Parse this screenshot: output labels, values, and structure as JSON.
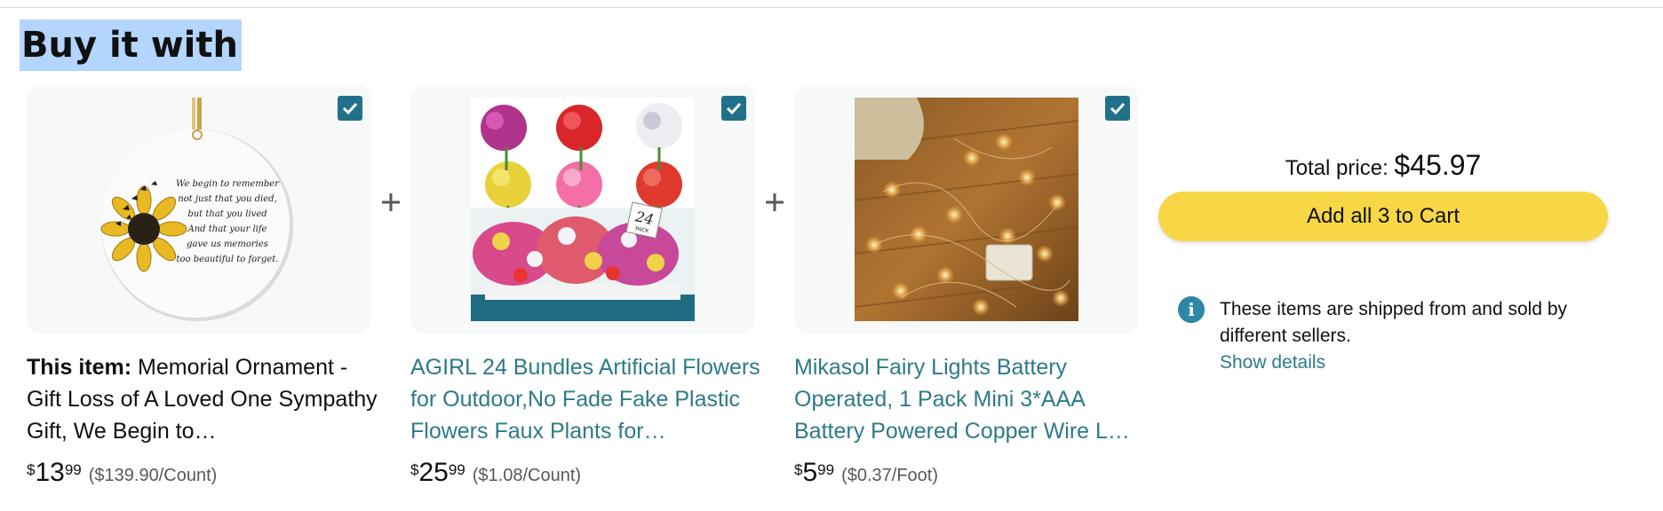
{
  "section": {
    "heading": "Buy it with"
  },
  "products": [
    {
      "label": "This item:",
      "title": "Memorial Ornament - Gift Loss of A Loved One Sympathy Gift, We Begin to…",
      "price_symbol": "$",
      "price_whole": "13",
      "price_fraction": "99",
      "unit_price": "($139.90/Count)",
      "checked": true,
      "ornament_lines": [
        "We begin to remember",
        "not just that you died,",
        "but that you lived",
        "And that your life",
        "gave us memories",
        "too beautiful to forget."
      ]
    },
    {
      "title": "AGIRL 24 Bundles Artificial Flowers for Outdoor,No Fade Fake Plastic Flowers Faux Plants for…",
      "price_symbol": "$",
      "price_whole": "25",
      "price_fraction": "99",
      "unit_price": "($1.08/Count)",
      "checked": true,
      "tag_number": "24",
      "tag_text": "PACK"
    },
    {
      "title": "Mikasol Fairy Lights Battery Operated, 1 Pack Mini 3*AAA Battery Powered Copper Wire L…",
      "price_symbol": "$",
      "price_whole": "5",
      "price_fraction": "99",
      "unit_price": "($0.37/Foot)",
      "checked": true
    }
  ],
  "summary": {
    "total_label": "Total price:",
    "total_amount": "$45.97",
    "add_button": "Add all 3 to Cart",
    "info_icon_glyph": "i",
    "info_text": "These items are shipped from and sold by different sellers.",
    "show_details": "Show details"
  },
  "colors": {
    "link": "#2d7a8a",
    "checkbox": "#21718a",
    "button": "#f7d745",
    "highlight": "#b4d5fe",
    "card": "#f7f8f8"
  },
  "icons": [
    "checkmark-icon",
    "plus-icon",
    "info-icon"
  ]
}
